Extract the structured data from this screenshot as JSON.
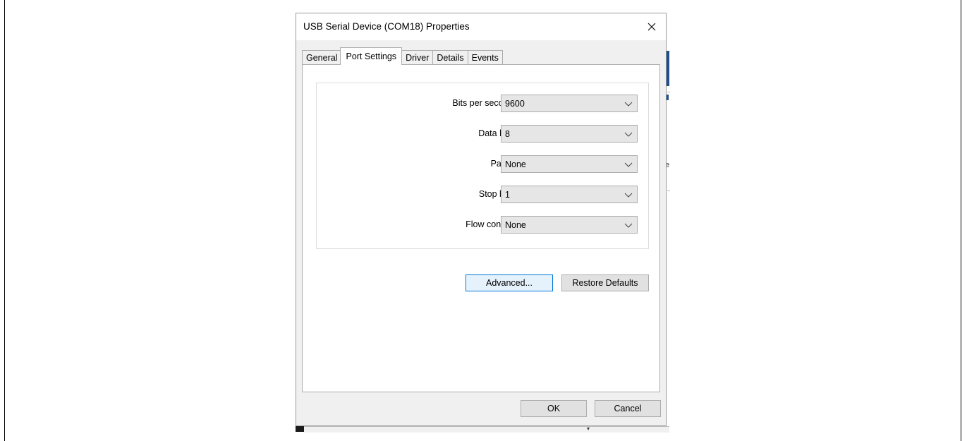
{
  "dialog": {
    "title": "USB Serial Device (COM18) Properties",
    "close_icon": "close-icon"
  },
  "tabs": [
    {
      "label": "General",
      "active": false
    },
    {
      "label": "Port Settings",
      "active": true
    },
    {
      "label": "Driver",
      "active": false
    },
    {
      "label": "Details",
      "active": false
    },
    {
      "label": "Events",
      "active": false
    }
  ],
  "settings": [
    {
      "label": "Bits per second:",
      "value": "9600"
    },
    {
      "label": "Data bits:",
      "value": "8"
    },
    {
      "label": "Parity:",
      "value": "None"
    },
    {
      "label": "Stop bits:",
      "value": "1"
    },
    {
      "label": "Flow control:",
      "value": "None"
    }
  ],
  "panel_buttons": {
    "advanced": "Advanced...",
    "restore_defaults": "Restore Defaults"
  },
  "footer_buttons": {
    "ok": "OK",
    "cancel": "Cancel"
  },
  "background": {
    "edge_char": "e"
  },
  "colors": {
    "dialog_bg": "#f0f0f0",
    "focus_border": "#0078d7",
    "combo_bg": "#e6e6e6"
  }
}
